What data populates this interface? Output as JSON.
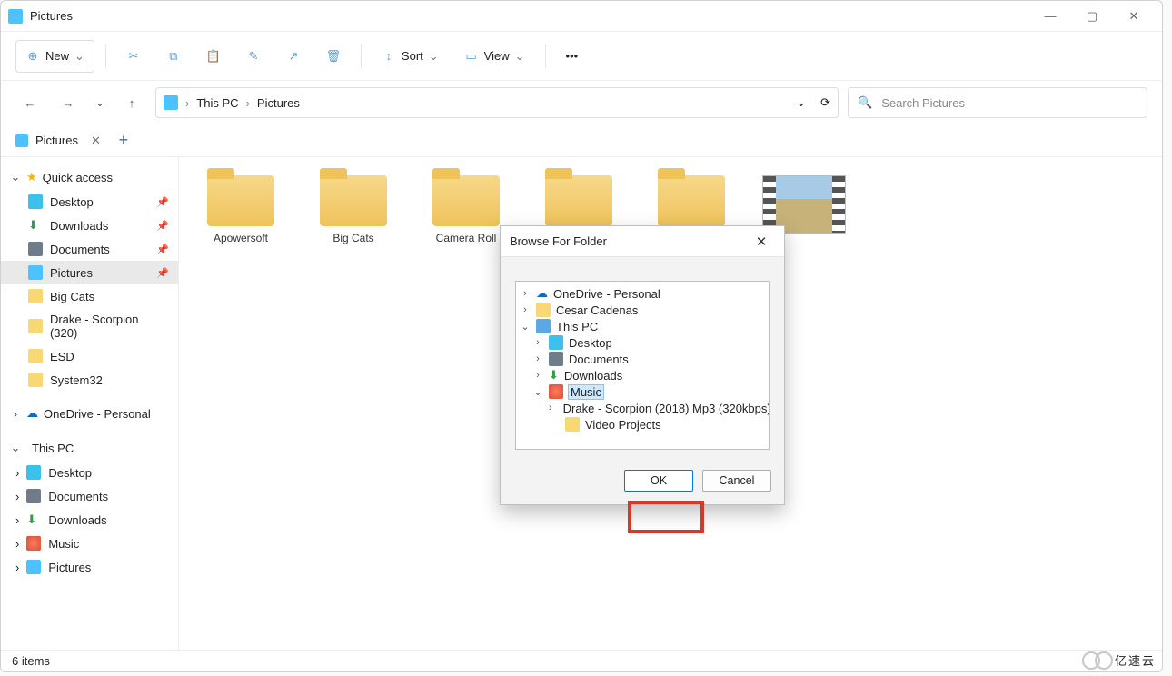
{
  "window": {
    "title": "Pictures"
  },
  "toolbar": {
    "new_label": "New",
    "sort_label": "Sort",
    "view_label": "View"
  },
  "breadcrumb": {
    "root": "This PC",
    "leaf": "Pictures"
  },
  "search": {
    "placeholder": "Search Pictures"
  },
  "tabs": {
    "active": "Pictures"
  },
  "sidebar": {
    "quick_access": "Quick access",
    "items": [
      {
        "label": "Desktop"
      },
      {
        "label": "Downloads"
      },
      {
        "label": "Documents"
      },
      {
        "label": "Pictures"
      },
      {
        "label": "Big Cats"
      },
      {
        "label": "Drake - Scorpion (320)"
      },
      {
        "label": "ESD"
      },
      {
        "label": "System32"
      }
    ],
    "onedrive": "OneDrive - Personal",
    "this_pc": "This PC",
    "pc_items": [
      {
        "label": "Desktop"
      },
      {
        "label": "Documents"
      },
      {
        "label": "Downloads"
      },
      {
        "label": "Music"
      },
      {
        "label": "Pictures"
      }
    ]
  },
  "folders": [
    {
      "name": "Apowersoft"
    },
    {
      "name": "Big Cats"
    },
    {
      "name": "Camera Roll"
    },
    {
      "name": ""
    },
    {
      "name": ""
    }
  ],
  "status": {
    "text": "6 items"
  },
  "dialog": {
    "title": "Browse For Folder",
    "tree": [
      {
        "label": "OneDrive - Personal"
      },
      {
        "label": "Cesar Cadenas"
      },
      {
        "label": "This PC"
      },
      {
        "label": "Desktop"
      },
      {
        "label": "Documents"
      },
      {
        "label": "Downloads"
      },
      {
        "label": "Music"
      },
      {
        "label": "Drake - Scorpion (2018) Mp3 (320kbps)"
      },
      {
        "label": "Video Projects"
      }
    ],
    "ok": "OK",
    "cancel": "Cancel"
  },
  "watermark": "亿速云"
}
